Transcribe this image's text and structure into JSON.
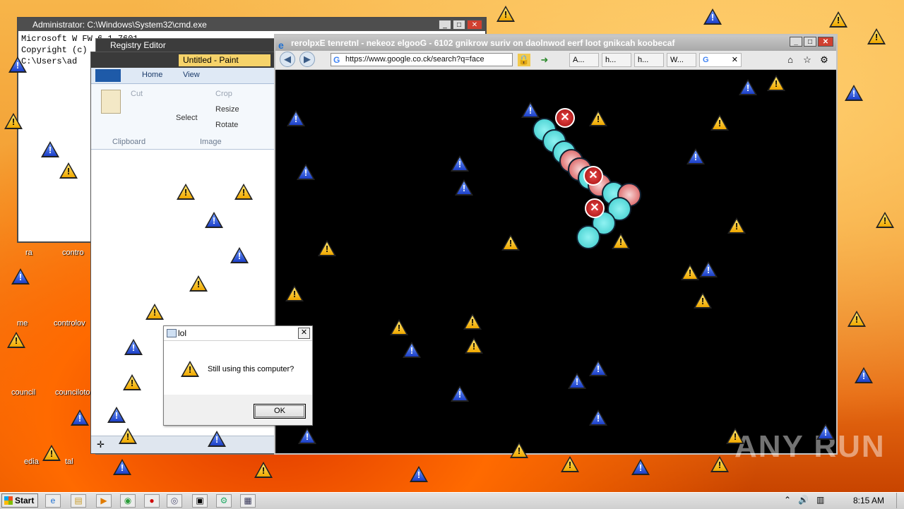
{
  "cmd": {
    "title": "Administrator: C:\\Windows\\System32\\cmd.exe",
    "lines": [
      "Microsoft W     FW     6.1.7601",
      "Copyright (c)",
      "C:\\Users\\ad"
    ]
  },
  "registry": {
    "title": "Registry Editor"
  },
  "paint": {
    "title": "Untitled - Paint",
    "tab_home": "Home",
    "tab_view": "View",
    "cut": "Cut",
    "crop": "Crop",
    "resize": "Resize",
    "rotate": "Rotate",
    "select": "Select",
    "group_clipboard": "Clipboard",
    "group_image": "Image"
  },
  "browser": {
    "title": "rerolpxE tenretnI - nekeoz elgooG - 6102 gnikrow suriv on daolnwod eerf loot gnikcah koobecaf",
    "address": "https://www.google.co.ck/search?q=face",
    "tabs": [
      "A...",
      "h...",
      "h...",
      "W..."
    ]
  },
  "dialog": {
    "title": "lol",
    "message": "Still using this computer?",
    "ok": "OK"
  },
  "desktop": {
    "labels": [
      "ra",
      "contro",
      "me",
      "controlov",
      "council",
      "counciloto",
      "edia",
      "tal"
    ],
    "watermark": "ANY RUN"
  },
  "taskbar": {
    "start": "Start",
    "clock": "8:15 AM"
  },
  "colors": {
    "warning": "#f5c400",
    "info": "#1c3fc7",
    "error": "#c41414",
    "accent": "#f29a2e"
  }
}
